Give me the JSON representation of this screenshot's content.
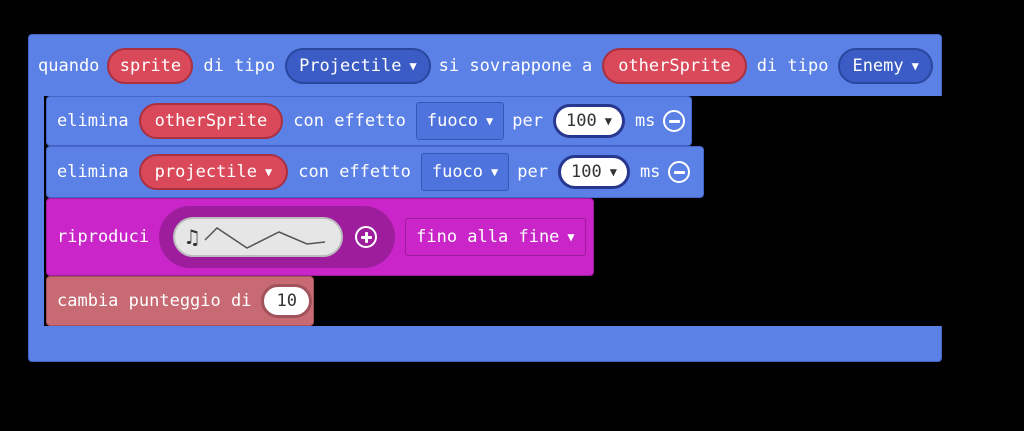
{
  "event_block": {
    "word_when": "quando",
    "sprite_var": "sprite",
    "of_type_1": "di tipo",
    "kind_1": "Projectile",
    "overlaps": "si sovrappone a",
    "other_var": "otherSprite",
    "of_type_2": "di tipo",
    "kind_2": "Enemy"
  },
  "destroy_1": {
    "label": "elimina",
    "target": "otherSprite",
    "with_effect": "con effetto",
    "effect": "fuoco",
    "for": "per",
    "duration": "100",
    "unit": "ms"
  },
  "destroy_2": {
    "label": "elimina",
    "target": "projectile",
    "with_effect": "con effetto",
    "effect": "fuoco",
    "for": "per",
    "duration": "100",
    "unit": "ms"
  },
  "play_block": {
    "label": "riproduci",
    "mode": "fino alla fine"
  },
  "score_block": {
    "label": "cambia punteggio di",
    "value": "10"
  },
  "colors": {
    "sprites_blue": "#5b80e6",
    "music_magenta": "#c925c9",
    "info_rose": "#c76a73",
    "var_red": "#d9495a"
  },
  "icons": [
    "music-note-icon",
    "dropdown-arrow-icon",
    "minus-circle-icon",
    "plus-circle-icon"
  ]
}
